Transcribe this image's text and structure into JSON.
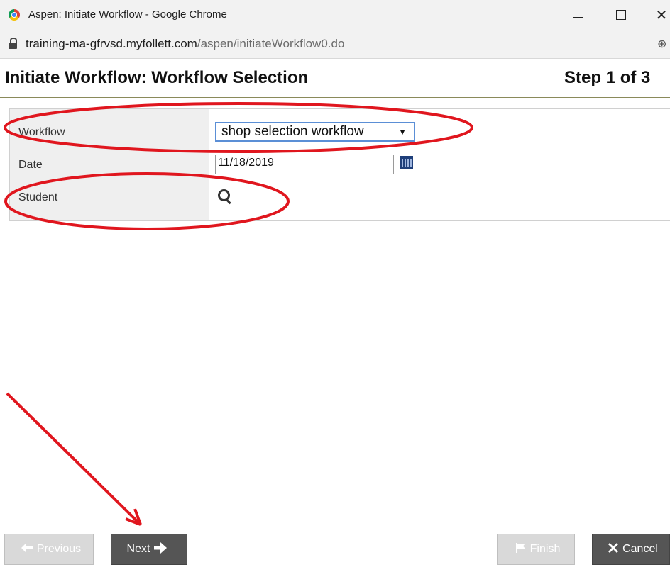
{
  "window": {
    "title": "Aspen: Initiate Workflow - Google Chrome",
    "url_host": "training-ma-gfrvsd.myfollett.com",
    "url_path": "/aspen/initiateWorkflow0.do",
    "close_glyph": "✕"
  },
  "page": {
    "title": "Initiate Workflow: Workflow Selection",
    "step": "Step 1 of 3"
  },
  "form": {
    "workflow_label": "Workflow",
    "workflow_value": "shop selection workflow",
    "date_label": "Date",
    "date_value": "11/18/2019",
    "student_label": "Student"
  },
  "buttons": {
    "previous": "Previous",
    "next": "Next",
    "finish": "Finish",
    "cancel": "Cancel"
  },
  "icons": {
    "previous": "arrow-left-icon",
    "next": "arrow-right-icon",
    "finish": "flag-icon",
    "cancel": "x-icon",
    "calendar": "calendar-icon",
    "student_search": "search-icon"
  },
  "colors": {
    "annotation": "#e0161e",
    "select_border": "#5b8fd6",
    "dark_button": "#555555",
    "disabled_button": "#d9d9d9"
  }
}
